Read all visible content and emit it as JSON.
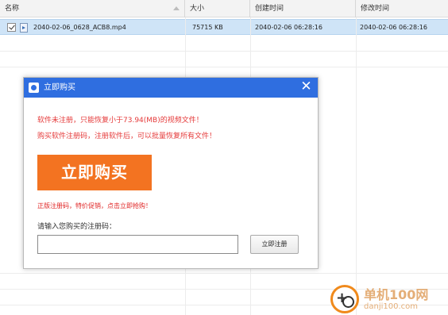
{
  "columns": {
    "name": "名称",
    "size": "大小",
    "created": "创建时间",
    "modified": "修改时间"
  },
  "files": [
    {
      "name": "2040-02-06_0628_ACB8.mp4",
      "size": "75715 KB",
      "created": "2040-02-06  06:28:16",
      "modified": "2040-02-06  06:28:16",
      "checked": true
    }
  ],
  "dialog": {
    "title": "立即购买",
    "close": "✕",
    "message_line1": "软件未注册，只能恢复小于73.94(MB)的视频文件！",
    "message_line2": "购买软件注册码，注册软件后，可以批量恢复所有文件！",
    "buy_button": "立即购买",
    "promo": "正版注册码，特价促销，点击立即抢购！",
    "reg_label": "请输入您购买的注册码：",
    "reg_input_value": "",
    "reg_button": "立即注册"
  },
  "watermark": {
    "title": "单机100网",
    "url": "danji100.com"
  },
  "colors": {
    "titlebar": "#2f6ee0",
    "buy_button": "#f37321",
    "warning_text": "#e53a3a",
    "selected_row": "#cfe4f7"
  }
}
